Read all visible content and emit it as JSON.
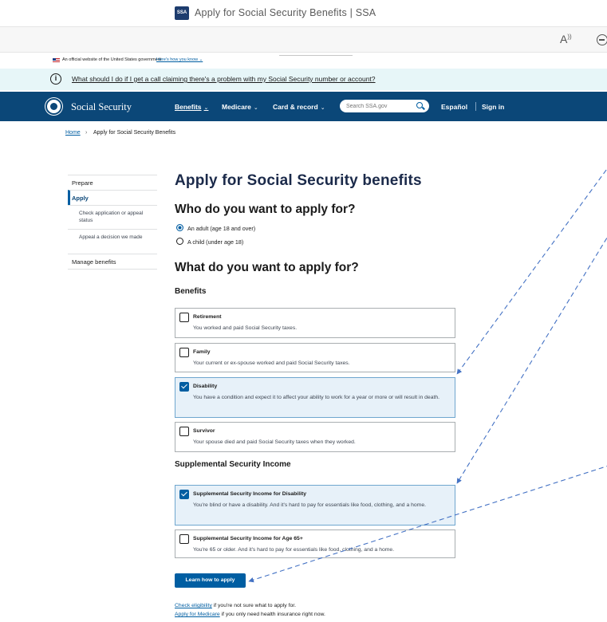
{
  "browser": {
    "tab_title": "Apply for Social Security Benefits | SSA",
    "favicon_text": "SSA",
    "read_aloud_label": "A̅⁾"
  },
  "gov_banner": {
    "text": "An official website of the United States government",
    "link": "Here's how you know ⌄"
  },
  "alert": {
    "icon": "i",
    "link": "What should I do if I get a call claiming there's a problem with my Social Security number or account?"
  },
  "nav": {
    "logo_text": "Social Security",
    "items": [
      {
        "label": "Benefits"
      },
      {
        "label": "Medicare"
      },
      {
        "label": "Card & record"
      }
    ],
    "chevron": "⌄",
    "search_placeholder": "Search SSA.gov",
    "espanol": "Español",
    "signin": "Sign in"
  },
  "breadcrumb": {
    "home": "Home",
    "separator": "›",
    "current": "Apply for Social Security Benefits"
  },
  "sidenav": {
    "prepare": "Prepare",
    "apply": "Apply",
    "check_status": "Check application or appeal status",
    "appeal": "Appeal a decision we made",
    "manage": "Manage benefits"
  },
  "main": {
    "title": "Apply for Social Security benefits",
    "who_heading": "Who do you want to apply for?",
    "who_options": [
      {
        "label": "An adult (age 18 and over)",
        "selected": true
      },
      {
        "label": "A child (under age 18)",
        "selected": false
      }
    ],
    "what_heading": "What do you want to apply for?",
    "benefits_heading": "Benefits",
    "benefits": [
      {
        "title": "Retirement",
        "desc": "You worked and paid Social Security taxes.",
        "checked": false
      },
      {
        "title": "Family",
        "desc": "Your current or ex-spouse worked and paid Social Security taxes.",
        "checked": false
      },
      {
        "title": "Disability",
        "desc": "You have a condition and expect it to affect your ability to work for a year or more or will result in death.",
        "checked": true
      },
      {
        "title": "Survivor",
        "desc": "Your spouse died and paid Social Security taxes when they worked.",
        "checked": false
      }
    ],
    "ssi_heading": "Supplemental Security Income",
    "ssi": [
      {
        "title": "Supplemental Security Income for Disability",
        "desc": "You're blind or have a disability. And it's hard to pay for essentials like food, clothing, and a home.",
        "checked": true
      },
      {
        "title": "Supplemental Security Income for Age 65+",
        "desc": "You're 65 or older. And it's hard to pay for essentials like food, clothing, and a home.",
        "checked": false
      }
    ],
    "button": "Learn how to apply",
    "footer": [
      {
        "link": "Check eligibility",
        "text": " if you're not sure what to apply for."
      },
      {
        "link": "Apply for Medicare",
        "text": " if you only need health insurance right now."
      }
    ]
  },
  "colors": {
    "nav_bg": "#0b4778",
    "primary": "#005ea2",
    "alert_bg": "#e7f6f8",
    "selected_tile_bg": "#e7f1f9",
    "annotation_arrow": "#4472c4"
  }
}
